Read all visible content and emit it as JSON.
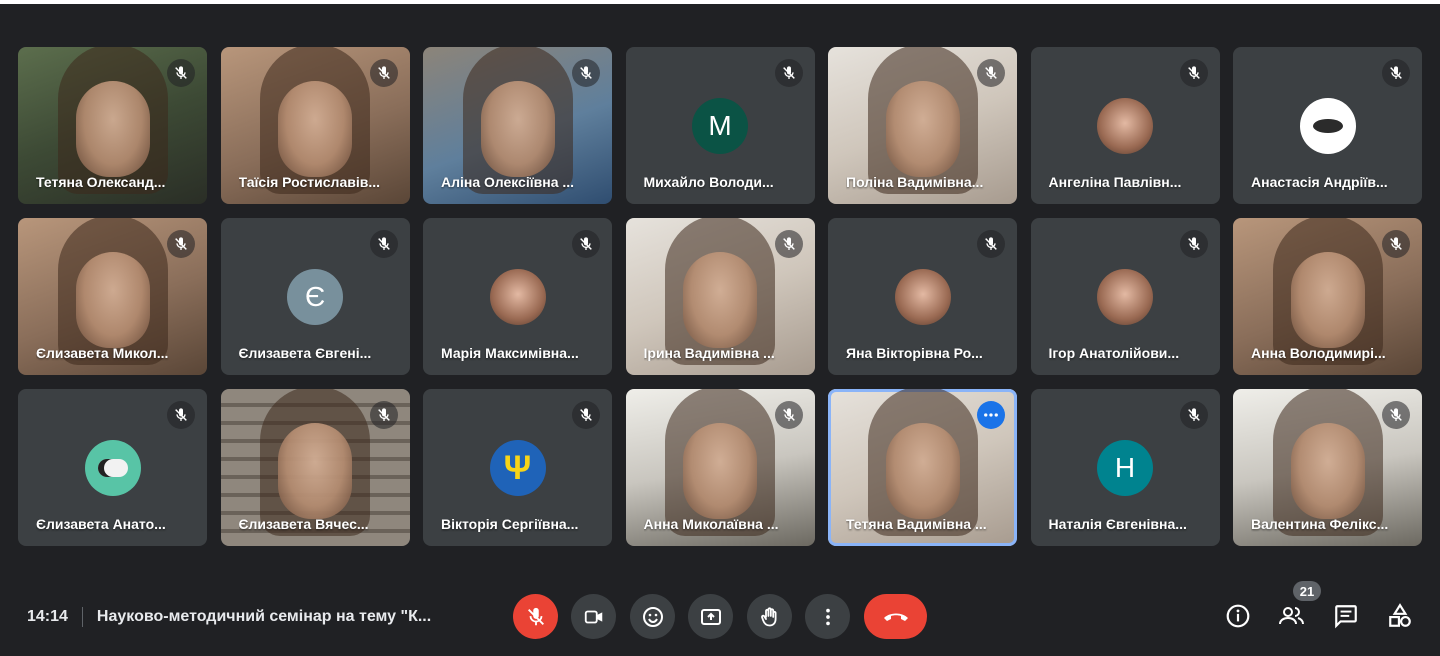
{
  "participants": [
    {
      "name": "Тетяна Олександ...",
      "type": "video",
      "style": "green"
    },
    {
      "name": "Таїсія Ростиславів...",
      "type": "video",
      "style": "peach"
    },
    {
      "name": "Аліна Олексіївна ...",
      "type": "video",
      "style": "blue"
    },
    {
      "name": "Михайло Володи...",
      "type": "letter",
      "letter": "M",
      "color": "#0b5345"
    },
    {
      "name": "Поліна Вадимівна...",
      "type": "video",
      "style": "light"
    },
    {
      "name": "Ангеліна Павлівн...",
      "type": "photo-avatar",
      "icon": "photo"
    },
    {
      "name": "Анастасія Андріїв...",
      "type": "photo-avatar",
      "icon": "insect"
    },
    {
      "name": "Єлизавета Микол...",
      "type": "video",
      "style": "peach"
    },
    {
      "name": "Єлизавета Євгені...",
      "type": "letter",
      "letter": "Є",
      "color": "#78909c"
    },
    {
      "name": "Марія Максимівна...",
      "type": "photo-avatar",
      "icon": "photo"
    },
    {
      "name": "Ірина Вадимівна ...",
      "type": "video",
      "style": "light"
    },
    {
      "name": "Яна Вікторівна Ро...",
      "type": "photo-avatar",
      "icon": "photo"
    },
    {
      "name": "Ігор Анатолійови...",
      "type": "photo-avatar",
      "icon": "photo"
    },
    {
      "name": "Анна Володимирі...",
      "type": "video",
      "style": "peach"
    },
    {
      "name": "Єлизавета Анато...",
      "type": "photo-avatar",
      "icon": "panda"
    },
    {
      "name": "Єлизавета Вячес...",
      "type": "video",
      "style": "wood"
    },
    {
      "name": "Вікторія Сергіївна...",
      "type": "photo-avatar",
      "icon": "trident"
    },
    {
      "name": "Анна Миколаївна ...",
      "type": "video",
      "style": "room"
    },
    {
      "name": "Тетяна Вадимівна ...",
      "type": "video",
      "style": "light",
      "active": true
    },
    {
      "name": "Наталія Євгенівна...",
      "type": "letter",
      "letter": "H",
      "color": "#00838f"
    },
    {
      "name": "Валентина Фелікс...",
      "type": "video",
      "style": "room"
    }
  ],
  "bottom_bar": {
    "time": "14:14",
    "meeting_title": "Науково-методичний семінар на тему \"К...",
    "participant_count": "21"
  },
  "colors": {
    "background": "#202124",
    "tile": "#3c4043",
    "danger": "#ea4335",
    "active_border": "#8ab4f8"
  },
  "icons": {
    "mic": "mic-off-icon",
    "camera": "camera-icon",
    "emoji": "emoji-icon",
    "present": "present-icon",
    "hand": "raise-hand-icon",
    "more": "more-vert-icon",
    "end": "end-call-icon",
    "info": "info-icon",
    "people": "people-icon",
    "chat": "chat-icon",
    "activities": "activities-icon"
  }
}
